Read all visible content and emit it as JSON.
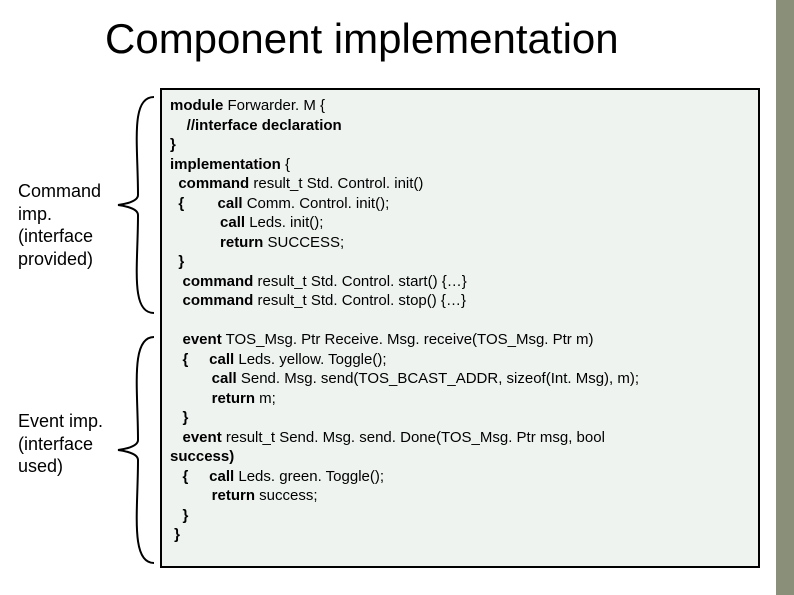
{
  "title": "Component implementation",
  "label1": "Command imp. (interface provided)",
  "label2": "Event imp. (interface used)",
  "code": {
    "l01a": "module",
    "l01b": " Forwarder. M {",
    "l02": "    //interface declaration",
    "l03": "}",
    "l04a": "implementation",
    "l04b": " {",
    "l05a": "  command",
    "l05b": " result_t Std. Control. init()",
    "l06a": "  {        call",
    "l06b": " Comm. Control. init();",
    "l07a": "            call",
    "l07b": " Leds. init();",
    "l08a": "            return",
    "l08b": " SUCCESS;",
    "l09": "  }",
    "l10a": "   command",
    "l10b": " result_t Std. Control. start() {…}",
    "l11a": "   command",
    "l11b": " result_t Std. Control. stop() {…}",
    "l12": " ",
    "l13a": "   event",
    "l13b": " TOS_Msg. Ptr Receive. Msg. receive(TOS_Msg. Ptr m)",
    "l14a": "   {     call",
    "l14b": " Leds. yellow. Toggle();",
    "l15a": "          call",
    "l15b": " Send. Msg. send(TOS_BCAST_ADDR, sizeof(Int. Msg), m);",
    "l16a": "          return",
    "l16b": " m;",
    "l17": "   }",
    "l18a": "   event",
    "l18b": " result_t Send. Msg. send. Done(TOS_Msg. Ptr msg, bool",
    "l19": "success)",
    "l20a": "   {     call",
    "l20b": " Leds. green. Toggle();",
    "l21a": "          return",
    "l21b": " success;",
    "l22": "   }",
    "l23": " }"
  }
}
